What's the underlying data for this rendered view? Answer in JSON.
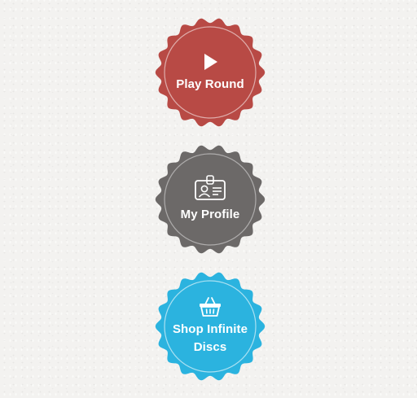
{
  "menu": {
    "items": [
      {
        "label": "Play Round",
        "icon": "play-icon",
        "color": "#b84a45"
      },
      {
        "label": "My Profile",
        "icon": "id-card-icon",
        "color": "#6c6968"
      },
      {
        "label": "Shop Infinite Discs",
        "icon": "shopping-basket-icon",
        "color": "#2bb3df"
      }
    ]
  }
}
